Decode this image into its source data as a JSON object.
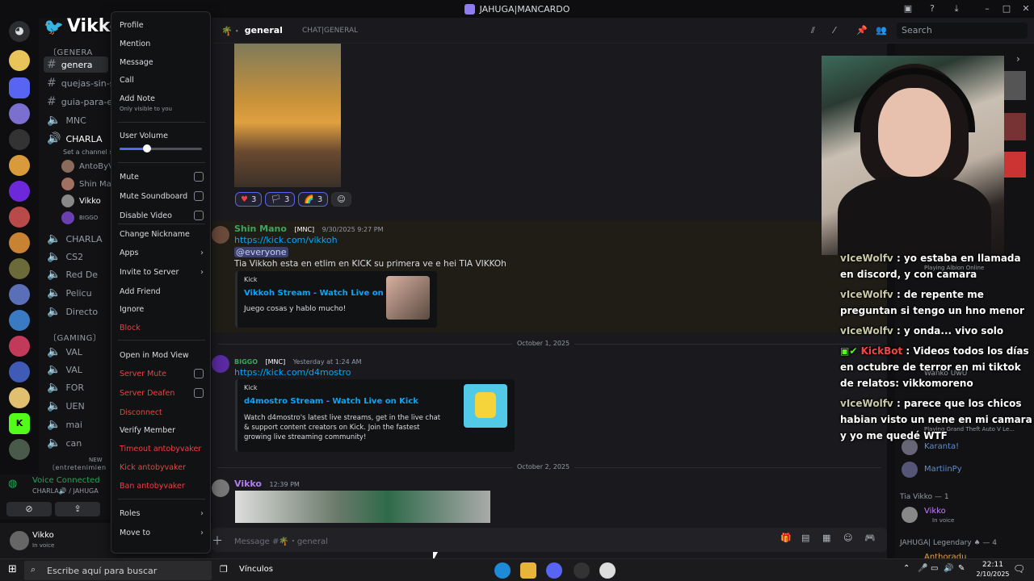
{
  "titlebar": {
    "title": "JAHUGA|MANCARDO"
  },
  "channel_header": {
    "channel": "general",
    "topic": "CHAT|GENERAL",
    "search_placeholder": "Search"
  },
  "channels": {
    "server_name": "JAHUGA|MANCARDO",
    "cat_general": "〔GENERA",
    "items": [
      "genera",
      "quejas-sin-se",
      "guia-para-en",
      "MNC",
      "CHARLA",
      "CHARLA",
      "CS2",
      "Red De",
      "Pelicu",
      "Directo"
    ],
    "set_status": "Set a channel sta",
    "voice_users": [
      "AntoByVa",
      "Shin Man",
      "Vikko",
      "BIGGO"
    ],
    "cat_gaming": "〔GAMING〕",
    "gaming_items": [
      "VAL",
      "VAL",
      "FOR",
      "UEN",
      "mai",
      "can"
    ],
    "new_label": "NEW",
    "bottom_cat": "〔entretenimien"
  },
  "voice_status": {
    "title": "Voice Connected",
    "channel": "CHARLA🔊 / JAHUGA"
  },
  "user": {
    "name": "Vikko",
    "status": "In voice"
  },
  "overlay_brand": "Vikkoh",
  "messages": {
    "reactions": [
      {
        "emoji": "♥",
        "count": "3"
      },
      {
        "emoji": "🏳",
        "count": "3"
      },
      {
        "emoji": "🌈",
        "count": "3"
      }
    ],
    "m1": {
      "author": "Shin Mano",
      "badge": "[MNC]",
      "time": "9/30/2025 9:27 PM",
      "link": "https://kick.com/vikkoh",
      "mention": "@everyone",
      "text": "Tia Vikkoh esta en etlim en KICK su primera ve e hei TIA VIKKOh",
      "embed_provider": "Kick",
      "embed_title": "Vikkoh Stream - Watch Live on Kick",
      "embed_desc": "Juego cosas y hablo mucho!"
    },
    "date1": "October 1, 2025",
    "m2": {
      "author": "BIGGO",
      "badge": "[MNC]",
      "time": "Yesterday at 1:24 AM",
      "link": "https://kick.com/d4mostro",
      "embed_provider": "Kick",
      "embed_title": "d4mostro Stream - Watch Live on Kick",
      "embed_desc": "Watch d4mostro's latest live streams, get in the live chat & support content creators on Kick. Join the fastest growing live streaming community!"
    },
    "date2": "October 2, 2025",
    "m3": {
      "author": "Vikko",
      "time": "12:39 PM"
    },
    "input_placeholder": "Message #🌴・general"
  },
  "members": {
    "items": [
      "Playing Albion Online",
      "Wanko UwU",
      "Playing Grand Theft Auto V Le...",
      "Karanta!",
      "MartiinPy"
    ],
    "role_tia": "Tia Vikko — 1",
    "tia_member": "Vikko",
    "tia_status": "In voice",
    "role_legendary": "JAHUGA| Legendary ♠ — 4",
    "legendary_member": "Anthoradu"
  },
  "chat_overlay": [
    {
      "name": "vIceWolfv",
      "text": ": yo estaba en llamada en discord, y con camara"
    },
    {
      "name": "vIceWolfv",
      "text": ": de repente me preguntan si tengo un hno menor"
    },
    {
      "name": "vIceWolfv",
      "text": ": y onda... vivo solo"
    },
    {
      "name": "KickBot",
      "text": ": Videos todos los días en octubre de terror en mi tiktok de relatos: vikkomoreno"
    },
    {
      "name": "vIceWolfv",
      "text": ": parece que los chicos habian visto un nene en mi camara y yo me quedé WTF"
    }
  ],
  "context_menu": {
    "profile": "Profile",
    "mention": "Mention",
    "message": "Message",
    "call": "Call",
    "add_note": "Add Note",
    "add_note_sub": "Only visible to you",
    "user_volume": "User Volume",
    "user_volume_level": 0.33,
    "mute": "Mute",
    "mute_soundboard": "Mute Soundboard",
    "disable_video": "Disable Video",
    "change_nickname": "Change Nickname",
    "apps": "Apps",
    "invite": "Invite to Server",
    "add_friend": "Add Friend",
    "ignore": "Ignore",
    "block": "Block",
    "mod_view": "Open in Mod View",
    "server_mute": "Server Mute",
    "server_deafen": "Server Deafen",
    "disconnect": "Disconnect",
    "verify": "Verify Member",
    "timeout": "Timeout antobyvaker",
    "kick": "Kick antobyvaker",
    "ban": "Ban antobyvaker",
    "roles": "Roles",
    "move_to": "Move to"
  },
  "taskbar": {
    "search": "Escribe aquí para buscar",
    "links": "Vínculos",
    "time": "22:11",
    "date": "2/10/2025"
  },
  "colors": {
    "accent": "#5865f2",
    "danger": "#f23f43",
    "link": "#00a8fc",
    "kick_green": "#53fc18"
  }
}
